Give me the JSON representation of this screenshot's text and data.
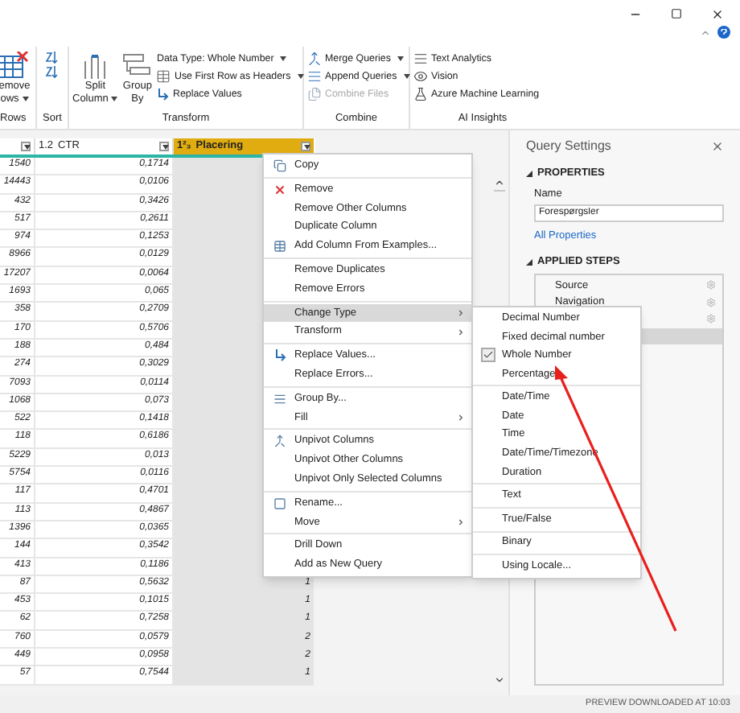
{
  "ribbon": {
    "groups": [
      {
        "label": "Rows",
        "large": [
          {
            "lines": [
              "emove",
              "ows"
            ],
            "dropdown": true
          }
        ]
      },
      {
        "label": "Sort"
      },
      {
        "label": "Transform",
        "large": [
          {
            "lines": [
              "Split",
              "Column"
            ],
            "dropdown": true
          },
          {
            "lines": [
              "Group",
              "By"
            ],
            "dropdown": false
          }
        ],
        "small": [
          {
            "label": "Data Type: Whole Number",
            "dropdown": true,
            "disabled": false
          },
          {
            "label": "Use First Row as Headers",
            "dropdown": true,
            "disabled": false
          },
          {
            "label": "Replace Values",
            "dropdown": false,
            "disabled": false
          }
        ]
      },
      {
        "label": "Combine",
        "small": [
          {
            "label": "Merge Queries",
            "dropdown": true,
            "disabled": false
          },
          {
            "label": "Append Queries",
            "dropdown": true,
            "disabled": false
          },
          {
            "label": "Combine Files",
            "dropdown": false,
            "disabled": true
          }
        ]
      },
      {
        "label": "AI Insights",
        "small": [
          {
            "label": "Text Analytics",
            "dropdown": false,
            "disabled": false
          },
          {
            "label": "Vision",
            "dropdown": false,
            "disabled": false
          },
          {
            "label": "Azure Machine Learning",
            "dropdown": false,
            "disabled": false
          }
        ]
      }
    ]
  },
  "table": {
    "columns": [
      {
        "type_label": "1.2",
        "name": "CTR",
        "selected": false
      },
      {
        "type_label": "1²₃",
        "name": "Placering",
        "selected": true
      }
    ],
    "rows": [
      {
        "column_1": "1540",
        "ctr": "0,1714"
      },
      {
        "column_1": "14443",
        "ctr": "0,0106"
      },
      {
        "column_1": "432",
        "ctr": "0,3426"
      },
      {
        "column_1": "517",
        "ctr": "0,2611"
      },
      {
        "column_1": "974",
        "ctr": "0,1253"
      },
      {
        "column_1": "8966",
        "ctr": "0,0129"
      },
      {
        "column_1": "17207",
        "ctr": "0,0064"
      },
      {
        "column_1": "1693",
        "ctr": "0,065"
      },
      {
        "column_1": "358",
        "ctr": "0,2709"
      },
      {
        "column_1": "170",
        "ctr": "0,5706"
      },
      {
        "column_1": "188",
        "ctr": "0,484"
      },
      {
        "column_1": "274",
        "ctr": "0,3029"
      },
      {
        "column_1": "7093",
        "ctr": "0,0114"
      },
      {
        "column_1": "1068",
        "ctr": "0,073"
      },
      {
        "column_1": "522",
        "ctr": "0,1418"
      },
      {
        "column_1": "118",
        "ctr": "0,6186"
      },
      {
        "column_1": "5229",
        "ctr": "0,013"
      },
      {
        "column_1": "5754",
        "ctr": "0,0116"
      },
      {
        "column_1": "117",
        "ctr": "0,4701"
      },
      {
        "column_1": "113",
        "ctr": "0,4867"
      },
      {
        "column_1": "1396",
        "ctr": "0,0365"
      },
      {
        "column_1": "144",
        "ctr": "0,3542"
      },
      {
        "column_1": "413",
        "ctr": "0,1186"
      },
      {
        "column_1": "87",
        "ctr": "0,5632",
        "placering": "1"
      },
      {
        "column_1": "453",
        "ctr": "0,1015",
        "placering": "1"
      },
      {
        "column_1": "62",
        "ctr": "0,7258",
        "placering": "1"
      },
      {
        "column_1": "760",
        "ctr": "0,0579",
        "placering": "2"
      },
      {
        "column_1": "449",
        "ctr": "0,0958",
        "placering": "2"
      },
      {
        "column_1": "57",
        "ctr": "0,7544",
        "placering": "1"
      }
    ]
  },
  "context_menu": {
    "groups": [
      [
        {
          "label": "Copy",
          "submenu": false,
          "highlighted": false
        }
      ],
      [
        {
          "label": "Remove",
          "submenu": false,
          "highlighted": false
        },
        {
          "label": "Remove Other Columns",
          "submenu": false,
          "highlighted": false
        },
        {
          "label": "Duplicate Column",
          "submenu": false,
          "highlighted": false
        },
        {
          "label": "Add Column From Examples...",
          "submenu": false,
          "highlighted": false
        }
      ],
      [
        {
          "label": "Remove Duplicates",
          "submenu": false,
          "highlighted": false
        },
        {
          "label": "Remove Errors",
          "submenu": false,
          "highlighted": false
        }
      ],
      [
        {
          "label": "Change Type",
          "submenu": true,
          "highlighted": true
        },
        {
          "label": "Transform",
          "submenu": true,
          "highlighted": false
        }
      ],
      [
        {
          "label": "Replace Values...",
          "submenu": false,
          "highlighted": false
        },
        {
          "label": "Replace Errors...",
          "submenu": false,
          "highlighted": false
        }
      ],
      [
        {
          "label": "Group By...",
          "submenu": false,
          "highlighted": false
        },
        {
          "label": "Fill",
          "submenu": true,
          "highlighted": false
        }
      ],
      [
        {
          "label": "Unpivot Columns",
          "submenu": false,
          "highlighted": false
        },
        {
          "label": "Unpivot Other Columns",
          "submenu": false,
          "highlighted": false
        },
        {
          "label": "Unpivot Only Selected Columns",
          "submenu": false,
          "highlighted": false
        }
      ],
      [
        {
          "label": "Rename...",
          "submenu": false,
          "highlighted": false
        },
        {
          "label": "Move",
          "submenu": true,
          "highlighted": false
        }
      ],
      [
        {
          "label": "Drill Down",
          "submenu": false,
          "highlighted": false
        },
        {
          "label": "Add as New Query",
          "submenu": false,
          "highlighted": false
        }
      ]
    ]
  },
  "submenu": {
    "groups": [
      [
        {
          "label": "Decimal Number",
          "checked": false
        },
        {
          "label": "Fixed decimal number",
          "checked": false
        },
        {
          "label": "Whole Number",
          "checked": true
        },
        {
          "label": "Percentage",
          "checked": false
        }
      ],
      [
        {
          "label": "Date/Time",
          "checked": false
        },
        {
          "label": "Date",
          "checked": false
        },
        {
          "label": "Time",
          "checked": false
        },
        {
          "label": "Date/Time/Timezone",
          "checked": false
        },
        {
          "label": "Duration",
          "checked": false
        }
      ],
      [
        {
          "label": "Text",
          "checked": false
        }
      ],
      [
        {
          "label": "True/False",
          "checked": false
        }
      ],
      [
        {
          "label": "Binary",
          "checked": false
        }
      ],
      [
        {
          "label": "Using Locale...",
          "checked": false
        }
      ]
    ]
  },
  "query_settings": {
    "title": "Query Settings",
    "properties": {
      "heading": "PROPERTIES",
      "name_label": "Name",
      "name_value": "Forespørgsler",
      "link": "All Properties"
    },
    "applied_steps": {
      "heading": "APPLIED STEPS",
      "steps": [
        {
          "label": "Source",
          "selected": false,
          "settings": true
        },
        {
          "label": "Navigation",
          "selected": false,
          "settings": true
        },
        {
          "selected": false,
          "settings": true
        },
        {
          "selected": true,
          "settings": false
        }
      ]
    }
  },
  "status_bar": "PREVIEW DOWNLOADED AT 10:03"
}
